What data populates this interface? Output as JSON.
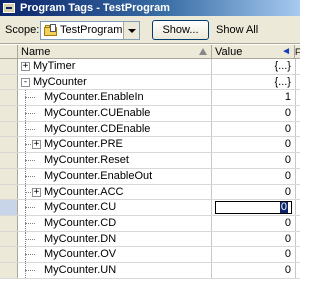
{
  "window": {
    "title": "Program Tags - TestProgram"
  },
  "toolbar": {
    "scope_label": "Scope:",
    "scope_value": "TestProgram",
    "show_button": "Show...",
    "show_filter": "Show All"
  },
  "table": {
    "col_name": "Name",
    "col_value": "Value",
    "rows": [
      {
        "name": "MyTimer",
        "value": "{...}",
        "level": 0,
        "expander": "+"
      },
      {
        "name": "MyCounter",
        "value": "{...}",
        "level": 0,
        "expander": "-"
      },
      {
        "name": "MyCounter.EnableIn",
        "value": "1",
        "level": 1
      },
      {
        "name": "MyCounter.CUEnable",
        "value": "0",
        "level": 1
      },
      {
        "name": "MyCounter.CDEnable",
        "value": "0",
        "level": 1
      },
      {
        "name": "MyCounter.PRE",
        "value": "0",
        "level": 1,
        "expander": "+"
      },
      {
        "name": "MyCounter.Reset",
        "value": "0",
        "level": 1
      },
      {
        "name": "MyCounter.EnableOut",
        "value": "0",
        "level": 1
      },
      {
        "name": "MyCounter.ACC",
        "value": "0",
        "level": 1,
        "expander": "+"
      },
      {
        "name": "MyCounter.CU",
        "value": "0",
        "level": 1,
        "editing": true
      },
      {
        "name": "MyCounter.CD",
        "value": "0",
        "level": 1
      },
      {
        "name": "MyCounter.DN",
        "value": "0",
        "level": 1
      },
      {
        "name": "MyCounter.OV",
        "value": "0",
        "level": 1
      },
      {
        "name": "MyCounter.UN",
        "value": "0",
        "level": 1
      }
    ]
  },
  "colors": {
    "title_start": "#0a246a",
    "title_end": "#a6caf0",
    "chrome": "#ece9d8"
  }
}
